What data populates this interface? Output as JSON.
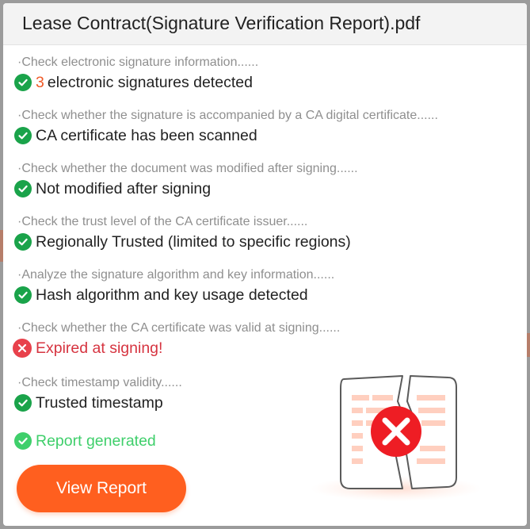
{
  "dialog": {
    "title": "Lease Contract(Signature Verification Report).pdf"
  },
  "checks": [
    {
      "description": "·Check electronic signature information......",
      "status": "ok",
      "count": "3",
      "result": "electronic signatures detected"
    },
    {
      "description": "·Check whether the signature is accompanied by a CA digital certificate......",
      "status": "ok",
      "result": "CA certificate has been scanned"
    },
    {
      "description": "·Check whether the document was modified after signing......",
      "status": "ok",
      "result": "Not modified after signing"
    },
    {
      "description": "·Check the trust level of the CA certificate issuer......",
      "status": "ok",
      "result": "Regionally Trusted (limited to specific regions)"
    },
    {
      "description": "·Analyze the signature algorithm and key information......",
      "status": "ok",
      "result": "Hash algorithm and key usage detected"
    },
    {
      "description": "·Check whether the CA certificate was valid at signing......",
      "status": "error",
      "result": "Expired at signing!"
    },
    {
      "description": "·Check timestamp validity......",
      "status": "ok",
      "result": "Trusted timestamp"
    }
  ],
  "report": {
    "status_text": "Report generated",
    "button_label": "View Report"
  },
  "icons": {
    "ok": "check-circle-icon",
    "error": "x-circle-icon",
    "illustration": "broken-document-error-icon"
  },
  "colors": {
    "ok": "#1aa34a",
    "error": "#e8414b",
    "accent": "#ff5f1f",
    "report_text": "#3fcf6b"
  }
}
